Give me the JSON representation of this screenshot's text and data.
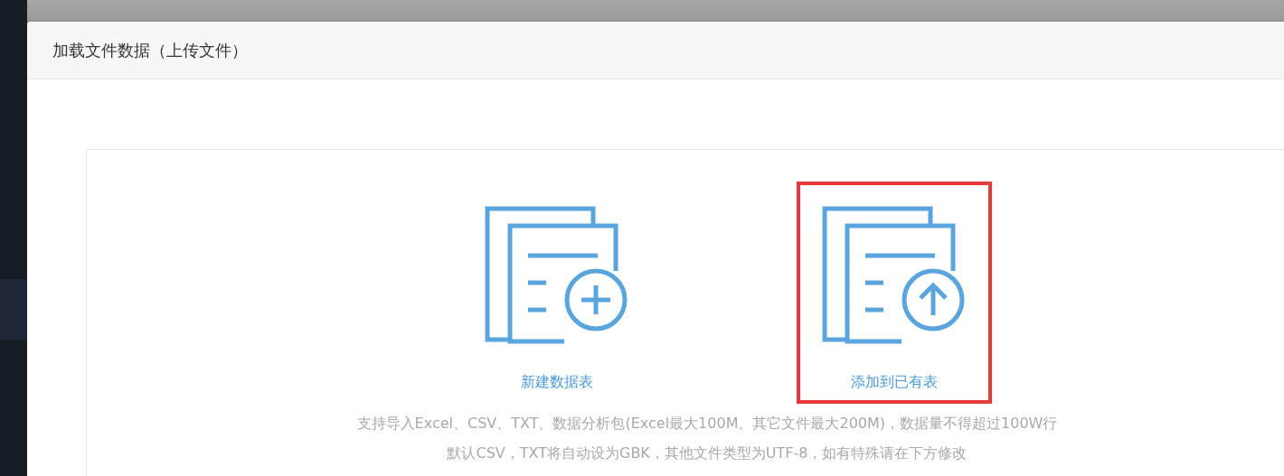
{
  "dialog": {
    "title": "加载文件数据（上传文件）",
    "options": [
      {
        "kind": "create",
        "label": "新建数据表",
        "selected": false
      },
      {
        "kind": "append",
        "label": "添加到已有表",
        "selected": true
      }
    ],
    "notes": [
      "支持导入Excel、CSV、TXT、数据分析包(Excel最大100M、其它文件最大200M)，数据量不得超过100W行",
      "默认CSV，TXT将自动设为GBK，其他文件类型为UTF-8，如有特殊请在下方修改"
    ]
  }
}
